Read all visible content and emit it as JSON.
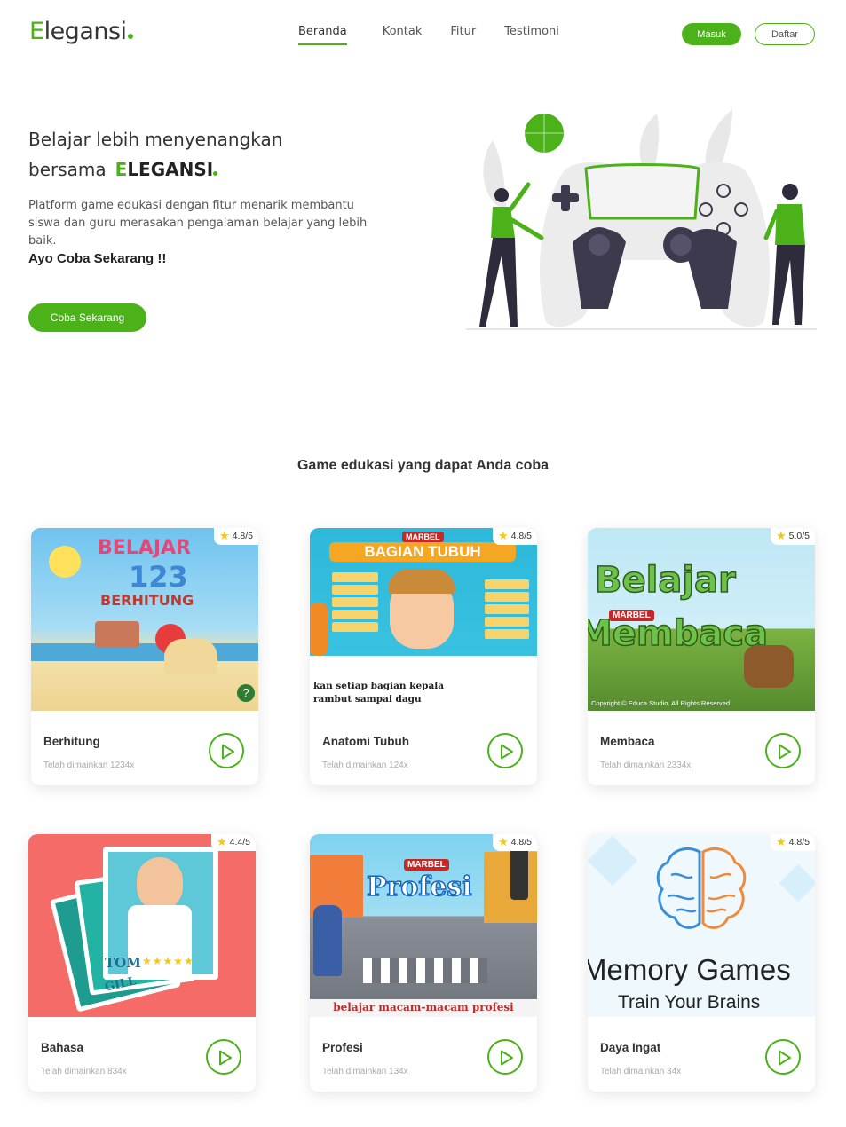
{
  "brand": {
    "first": "E",
    "rest": "legansi"
  },
  "nav": {
    "links": [
      "Beranda",
      "Kontak",
      "Fitur",
      "Testimoni"
    ],
    "login": "Masuk",
    "register": "Daftar"
  },
  "hero": {
    "line1": "Belajar lebih menyenangkan",
    "line2": "bersama",
    "brand_first": "E",
    "brand_rest": "LEGANSI",
    "description": "Platform game edukasi dengan fitur menarik membantu siswa dan guru merasakan pengalaman belajar yang lebih baik.",
    "cta_text": "Ayo Coba Sekarang !!",
    "cta_button": "Coba Sekarang"
  },
  "section": {
    "title": "Game edukasi yang dapat Anda coba"
  },
  "games": [
    {
      "title": "Berhitung",
      "plays": "Telah dimainkan 1234x",
      "rating": "4.8/5",
      "thumb_text": [
        "BELAJAR",
        "123",
        "BERHITUNG"
      ]
    },
    {
      "title": "Anatomi Tubuh",
      "plays": "Telah dimainkan 124x",
      "rating": "4.8/5",
      "thumb_text": [
        "MARBEL",
        "BAGIAN TUBUH",
        "kan setiap bagian kepala",
        "rambut sampai dagu"
      ]
    },
    {
      "title": "Membaca",
      "plays": "Telah dimainkan 2334x",
      "rating": "5.0/5",
      "thumb_text": [
        "Belajar",
        "MARBEL",
        "Membaca",
        "Copyright © Educa Studio. All Rights Reserved."
      ]
    },
    {
      "title": "Bahasa",
      "plays": "Telah dimainkan 834x",
      "rating": "4.4/5",
      "thumb_text": [
        "TOM",
        "GILL"
      ]
    },
    {
      "title": "Profesi",
      "plays": "Telah dimainkan 134x",
      "rating": "4.8/5",
      "thumb_text": [
        "MARBEL",
        "Profesi",
        "belajar macam-macam profesi"
      ]
    },
    {
      "title": "Daya Ingat",
      "plays": "Telah dimainkan 34x",
      "rating": "4.8/5",
      "thumb_text": [
        "Memory Games",
        "Train Your Brains"
      ]
    }
  ],
  "colors": {
    "accent": "#4bb21a",
    "star": "#f5c518"
  }
}
